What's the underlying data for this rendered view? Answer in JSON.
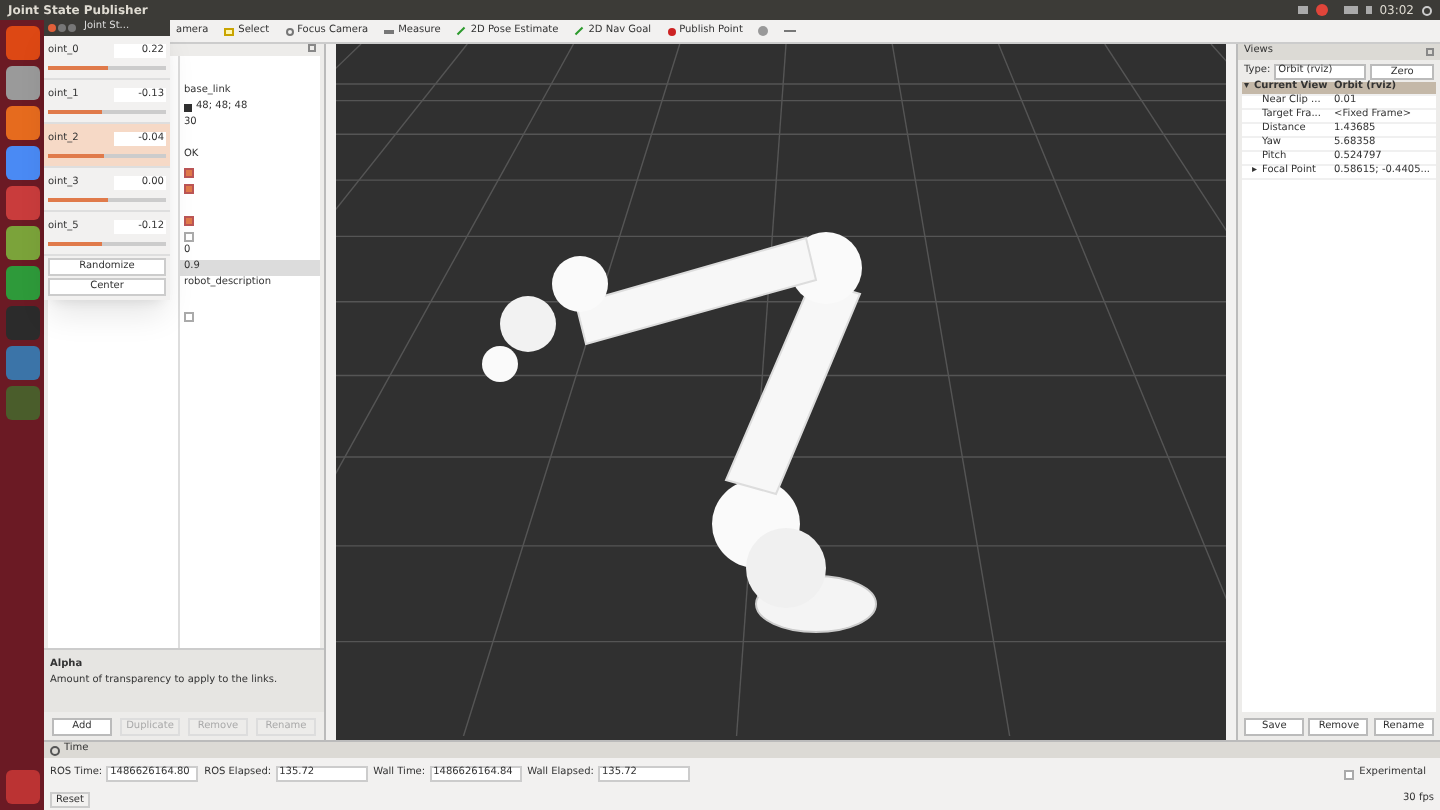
{
  "top_bar": {
    "title": "Joint State Publisher",
    "clock": "03:02"
  },
  "launcher": {
    "items": [
      {
        "kind": "ubuntu"
      },
      {
        "kind": "files"
      },
      {
        "kind": "software"
      },
      {
        "kind": "browser"
      },
      {
        "kind": "settings"
      },
      {
        "kind": "book"
      },
      {
        "kind": "sheet"
      },
      {
        "kind": "terminal"
      },
      {
        "kind": "python"
      },
      {
        "kind": "rv"
      }
    ]
  },
  "toolbar": {
    "items": [
      {
        "label": "amera",
        "kind": "plain"
      },
      {
        "label": "Select",
        "kind": "select"
      },
      {
        "label": "Focus Camera",
        "kind": "focus"
      },
      {
        "label": "Measure",
        "kind": "measure"
      },
      {
        "label": "2D Pose Estimate",
        "kind": "pose"
      },
      {
        "label": "2D Nav Goal",
        "kind": "goal"
      },
      {
        "label": "Publish Point",
        "kind": "point"
      }
    ]
  },
  "displays": {
    "values": [
      {
        "kind": "text",
        "text": "base_link",
        "selected": false
      },
      {
        "kind": "color",
        "text": "48; 48; 48",
        "color": "#303030",
        "selected": false
      },
      {
        "kind": "text",
        "text": "30",
        "selected": false
      },
      {
        "kind": "blank"
      },
      {
        "kind": "text",
        "text": "OK",
        "selected": false
      },
      {
        "kind": "check",
        "checked": true,
        "selected": false
      },
      {
        "kind": "check",
        "checked": true,
        "selected": false
      },
      {
        "kind": "blank"
      },
      {
        "kind": "check",
        "checked": true,
        "selected": false
      },
      {
        "kind": "check",
        "checked": false,
        "selected": false
      },
      {
        "kind": "text",
        "text": "0",
        "selected": false
      },
      {
        "kind": "text",
        "text": "0.9",
        "selected": true
      },
      {
        "kind": "text",
        "text": "robot_description",
        "selected": false
      },
      {
        "kind": "blank"
      },
      {
        "kind": "check",
        "checked": false,
        "selected": false
      }
    ],
    "help_title": "Alpha",
    "help_text": "Amount of transparency to apply to the links.",
    "buttons": [
      {
        "label": "Add",
        "disabled": false
      },
      {
        "label": "Duplicate",
        "disabled": true
      },
      {
        "label": "Remove",
        "disabled": true
      },
      {
        "label": "Rename",
        "disabled": true
      }
    ]
  },
  "joint_window": {
    "title": "Joint St...",
    "joints": [
      {
        "name": "oint_0",
        "value": "0.22",
        "level": 0.5,
        "selected": false
      },
      {
        "name": "oint_1",
        "value": "-0.13",
        "level": 0.46,
        "selected": false
      },
      {
        "name": "oint_2",
        "value": "-0.04",
        "level": 0.48,
        "selected": true
      },
      {
        "name": "oint_3",
        "value": "0.00",
        "level": 0.5,
        "selected": false
      },
      {
        "name": "oint_5",
        "value": "-0.12",
        "level": 0.46,
        "selected": false
      }
    ],
    "buttons": [
      "Randomize",
      "Center"
    ]
  },
  "views": {
    "title": "Views",
    "type_label": "Type:",
    "type_value": "Orbit (rviz)",
    "zero": "Zero",
    "rows": [
      {
        "name": "Current View",
        "value": "Orbit (rviz)",
        "kind": "header",
        "expander": "▾",
        "selected": true
      },
      {
        "name": "Near Clip ...",
        "value": "0.01",
        "kind": "leaf",
        "selected": false
      },
      {
        "name": "Target Fra...",
        "value": "<Fixed Frame>",
        "kind": "leaf",
        "selected": false
      },
      {
        "name": "Distance",
        "value": "1.43685",
        "kind": "leaf",
        "selected": false
      },
      {
        "name": "Yaw",
        "value": "5.68358",
        "kind": "leaf",
        "selected": false
      },
      {
        "name": "Pitch",
        "value": "0.524797",
        "kind": "leaf",
        "selected": false
      },
      {
        "name": "Focal Point",
        "value": "0.58615; -0.4405...",
        "kind": "collapsed",
        "expander": "▸",
        "selected": false
      }
    ],
    "buttons": [
      "Save",
      "Remove",
      "Rename"
    ]
  },
  "time": {
    "title": "Time",
    "fields": [
      {
        "label": "ROS Time:",
        "value": "1486626164.80"
      },
      {
        "label": "ROS Elapsed:",
        "value": "135.72"
      },
      {
        "label": "Wall Time:",
        "value": "1486626164.84"
      },
      {
        "label": "Wall Elapsed:",
        "value": "135.72"
      }
    ],
    "experimental": {
      "label": "Experimental",
      "checked": false
    },
    "reset": "Reset",
    "fps": "30 fps"
  }
}
